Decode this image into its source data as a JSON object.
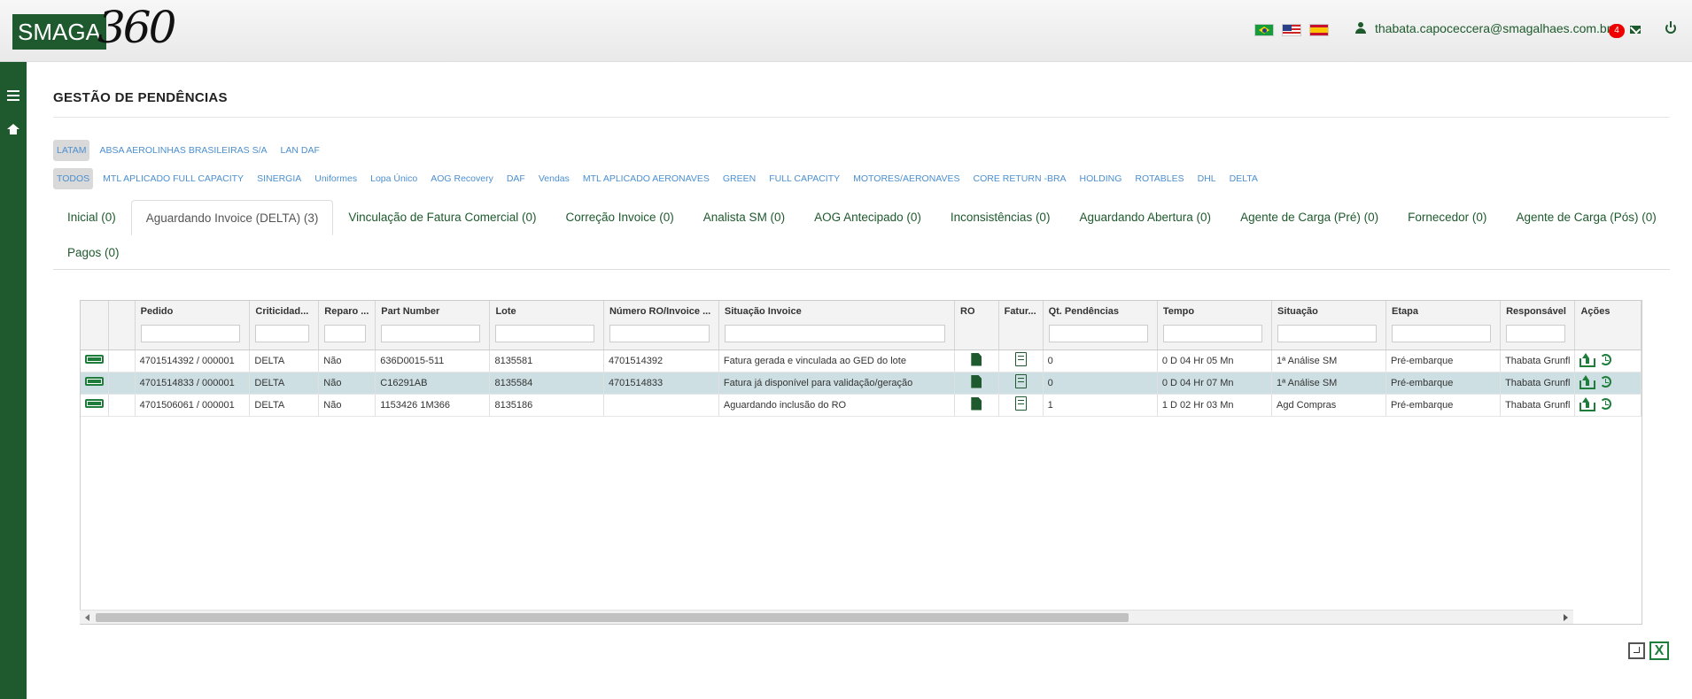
{
  "header": {
    "logo_text": "SMAGA",
    "logo_number": "360",
    "flags": [
      "flag-br",
      "flag-us",
      "flag-es"
    ],
    "user_email": "thabata.capoceccera@smagalhaes.com.br",
    "notification_count": "4"
  },
  "page": {
    "title": "GESTÃO DE PENDÊNCIAS"
  },
  "filters": {
    "companies": [
      "LATAM",
      "ABSA AEROLINHAS BRASILEIRAS S/A",
      "LAN DAF"
    ],
    "categories": [
      "TODOS",
      "MTL APLICADO FULL CAPACITY",
      "SINERGIA",
      "Uniformes",
      "Lopa Único",
      "AOG Recovery",
      "DAF",
      "Vendas",
      "MTL APLICADO AERONAVES",
      "GREEN",
      "FULL CAPACITY",
      "MOTORES/AERONAVES",
      "CORE RETURN -BRA",
      "HOLDING",
      "ROTABLES",
      "DHL",
      "DELTA"
    ]
  },
  "tabs": [
    "Inicial (0)",
    "Aguardando Invoice (DELTA) (3)",
    "Vinculação de Fatura Comercial (0)",
    "Correção Invoice (0)",
    "Analista SM (0)",
    "AOG Antecipado (0)",
    "Inconsistências (0)",
    "Aguardando Abertura (0)",
    "Agente de Carga (Pré) (0)",
    "Fornecedor (0)",
    "Agente de Carga (Pós) (0)",
    "Pagos (0)"
  ],
  "grid": {
    "columns": [
      "Pedido",
      "Criticidad...",
      "Reparo ...",
      "Part Number",
      "Lote",
      "Número RO/Invoice ...",
      "Situação Invoice",
      "RO",
      "Fatur...",
      "Qt. Pendências",
      "Tempo",
      "Situação",
      "Etapa",
      "Responsável",
      "Ações"
    ],
    "rows": [
      {
        "pedido": "4701514392 / 000001",
        "criticidade": "DELTA",
        "reparo": "Não",
        "part_number": "636D0015-511",
        "lote": "8135581",
        "numero_ro": "4701514392",
        "situacao_invoice": "Fatura gerada e vinculada ao GED do lote",
        "qt": "0",
        "tempo": "0 D 04 Hr 05 Mn",
        "situacao": "1ª Análise SM",
        "etapa": "Pré-embarque",
        "responsavel": "Thabata Grunfl"
      },
      {
        "pedido": "4701514833 / 000001",
        "criticidade": "DELTA",
        "reparo": "Não",
        "part_number": "C16291AB",
        "lote": "8135584",
        "numero_ro": "4701514833",
        "situacao_invoice": "Fatura já disponível para validação/geração",
        "qt": "0",
        "tempo": "0 D 04 Hr 07 Mn",
        "situacao": "1ª Análise SM",
        "etapa": "Pré-embarque",
        "responsavel": "Thabata Grunfl"
      },
      {
        "pedido": "4701506061 / 000001",
        "criticidade": "DELTA",
        "reparo": "Não",
        "part_number": "1153426 1M366",
        "lote": "8135186",
        "numero_ro": "",
        "situacao_invoice": "Aguardando inclusão do RO",
        "qt": "1",
        "tempo": "1 D 02 Hr 03 Mn",
        "situacao": "Agd Compras",
        "etapa": "Pré-embarque",
        "responsavel": "Thabata Grunfl"
      }
    ],
    "selected_row": 1,
    "horizontal_scroll_fraction": 0.69
  },
  "export": {
    "excel_label": "X"
  },
  "colors": {
    "brand_green": "#1e5a2d",
    "link_blue": "#4b8fd0",
    "selected_row": "#cddfe2"
  }
}
